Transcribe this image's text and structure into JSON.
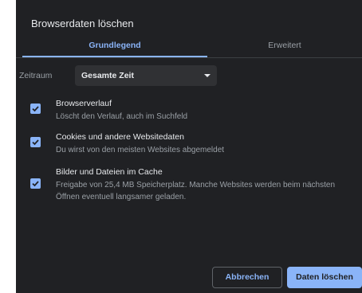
{
  "dialog": {
    "title": "Browserdaten löschen"
  },
  "tabs": {
    "basic": "Grundlegend",
    "advanced": "Erweitert"
  },
  "time_range": {
    "label": "Zeitraum",
    "value": "Gesamte Zeit"
  },
  "options": [
    {
      "title": "Browserverlauf",
      "description": "Löscht den Verlauf, auch im Suchfeld",
      "checked": true
    },
    {
      "title": "Cookies und andere Websitedaten",
      "description": "Du wirst von den meisten Websites abgemeldet",
      "checked": true
    },
    {
      "title": "Bilder und Dateien im Cache",
      "description": "Freigabe von 25,4 MB Speicherplatz. Manche Websites werden beim nächsten Öffnen eventuell langsamer geladen.",
      "checked": true
    }
  ],
  "buttons": {
    "cancel": "Abbrechen",
    "clear": "Daten löschen"
  },
  "colors": {
    "background": "#202124",
    "accent": "#8ab4f8",
    "text": "#e8eaed",
    "muted": "#9aa0a6"
  },
  "icons": {
    "checkbox": "checkmark-icon",
    "dropdown": "dropdown-arrow-icon"
  }
}
